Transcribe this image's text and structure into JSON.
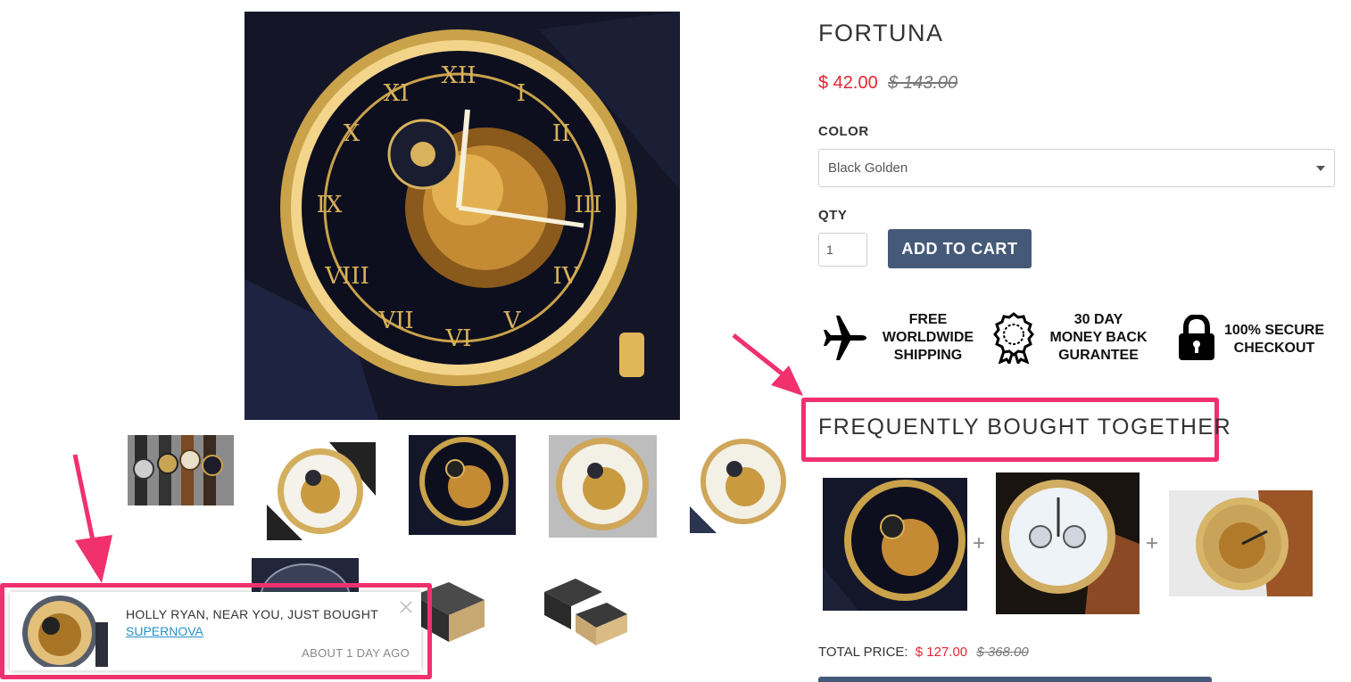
{
  "product": {
    "title": "FORTUNA",
    "price_sale": "$ 42.00",
    "price_old": "$ 143.00"
  },
  "options": {
    "color_label": "COLOR",
    "color_value": "Black Golden",
    "qty_label": "QTY",
    "qty_value": "1",
    "add_to_cart": "ADD TO CART"
  },
  "badges": [
    {
      "icon": "airplane-icon",
      "lines": [
        "FREE",
        "WORLDWIDE",
        "SHIPPING"
      ]
    },
    {
      "icon": "ribbon-badge-icon",
      "lines": [
        "30 DAY",
        "MONEY BACK",
        "GURANTEE"
      ]
    },
    {
      "icon": "padlock-icon",
      "lines": [
        "100% SECURE",
        "CHECKOUT"
      ]
    }
  ],
  "fbt": {
    "title": "FREQUENTLY BOUGHT TOGETHER",
    "plus": "+",
    "total_label": "TOTAL PRICE:",
    "total_sale": "$ 127.00",
    "total_old": "$ 368.00"
  },
  "popup": {
    "message": "HOLLY RYAN, NEAR YOU, JUST BOUGHT",
    "product_link": "SUPERNOVA",
    "time": "ABOUT 1 DAY AGO",
    "close_icon": "close-icon"
  },
  "colors": {
    "accent_red": "#e8232f",
    "button_blue": "#455a79",
    "highlight_pink": "#f1306e",
    "link_blue": "#2b8fc7"
  }
}
